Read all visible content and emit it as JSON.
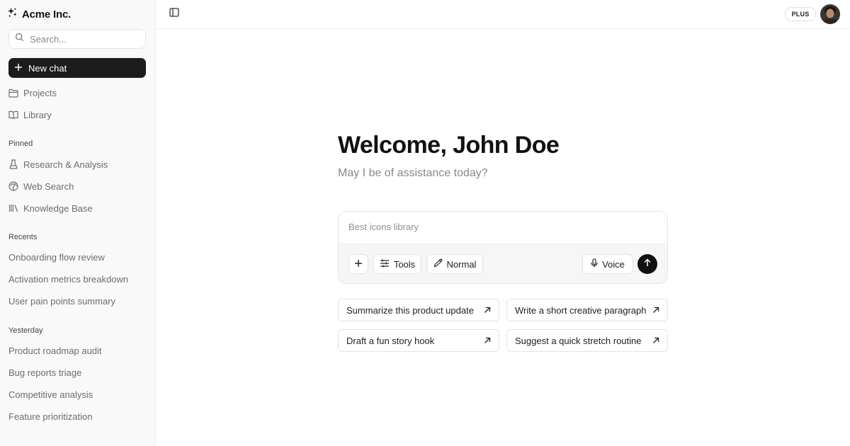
{
  "brand": {
    "name": "Acme Inc.",
    "icon": "sparkles-icon"
  },
  "search": {
    "placeholder": "Search..."
  },
  "sidebar": {
    "new_chat": "New chat",
    "nav": [
      {
        "label": "Projects",
        "icon": "folder-icon"
      },
      {
        "label": "Library",
        "icon": "book-icon"
      }
    ],
    "pinned_title": "Pinned",
    "pinned": [
      {
        "label": "Research & Analysis",
        "icon": "flask-icon"
      },
      {
        "label": "Web Search",
        "icon": "globe-icon"
      },
      {
        "label": "Knowledge Base",
        "icon": "books-icon"
      }
    ],
    "recents_title": "Recents",
    "recents": [
      "Onboarding flow review",
      "Activation metrics breakdown",
      "User pain points summary"
    ],
    "yesterday_title": "Yesterday",
    "yesterday": [
      "Product roadmap audit",
      "Bug reports triage",
      "Competitive analysis",
      "Feature prioritization"
    ]
  },
  "header": {
    "plan": "PLUS"
  },
  "main": {
    "title": "Welcome, John Doe",
    "subtitle": "May I be of assistance today?",
    "composer": {
      "placeholder": "Best icons library",
      "tools": "Tools",
      "mode": "Normal",
      "voice": "Voice"
    },
    "suggestions": [
      "Summarize this product update",
      "Write a short creative paragraph",
      "Draft a fun story hook",
      "Suggest a quick stretch routine"
    ]
  },
  "colors": {
    "accent": "#1c1c1c",
    "sidebar_bg": "#f9f9f9",
    "muted_text": "#6d6d6d"
  }
}
